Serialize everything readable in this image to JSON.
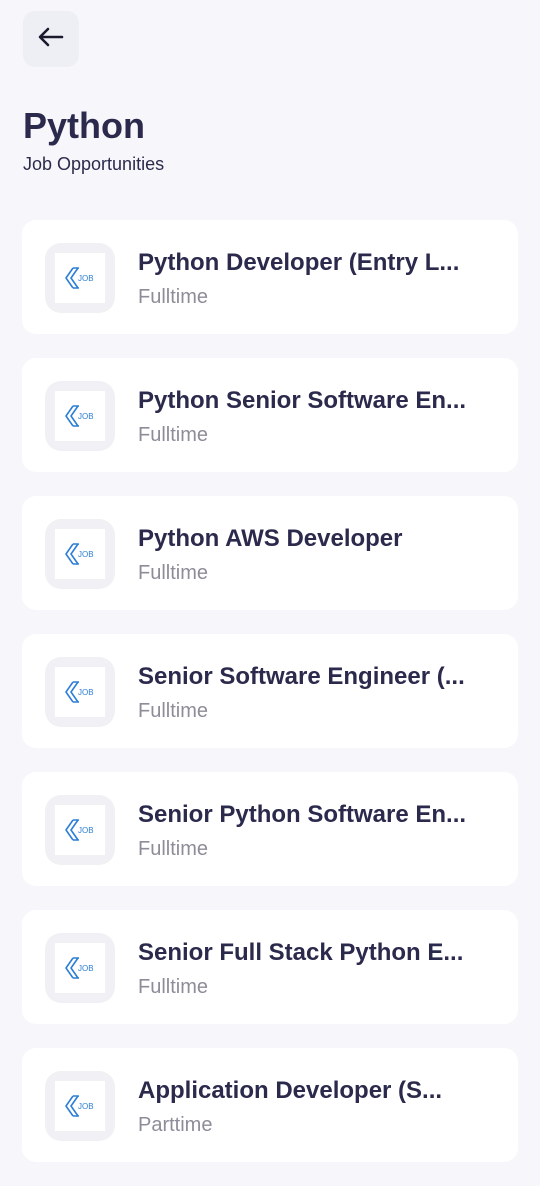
{
  "header": {
    "title": "Python",
    "subtitle": "Job Opportunities"
  },
  "icons": {
    "back": "arrow-left-icon",
    "job_logo": "job-logo-icon"
  },
  "colors": {
    "title": "#2b2a4c",
    "muted": "#8d8d99",
    "logo_blue": "#2d7fd6",
    "background": "#f7f7fb"
  },
  "logo_text": "JOB",
  "jobs": [
    {
      "title": "Python Developer (Entry L...",
      "type": "Fulltime"
    },
    {
      "title": "Python Senior Software En...",
      "type": "Fulltime"
    },
    {
      "title": "Python AWS Developer",
      "type": "Fulltime"
    },
    {
      "title": "Senior Software Engineer (...",
      "type": "Fulltime"
    },
    {
      "title": "Senior Python Software En...",
      "type": "Fulltime"
    },
    {
      "title": "Senior Full Stack Python E...",
      "type": "Fulltime"
    },
    {
      "title": "Application Developer (S...",
      "type": "Parttime"
    }
  ]
}
